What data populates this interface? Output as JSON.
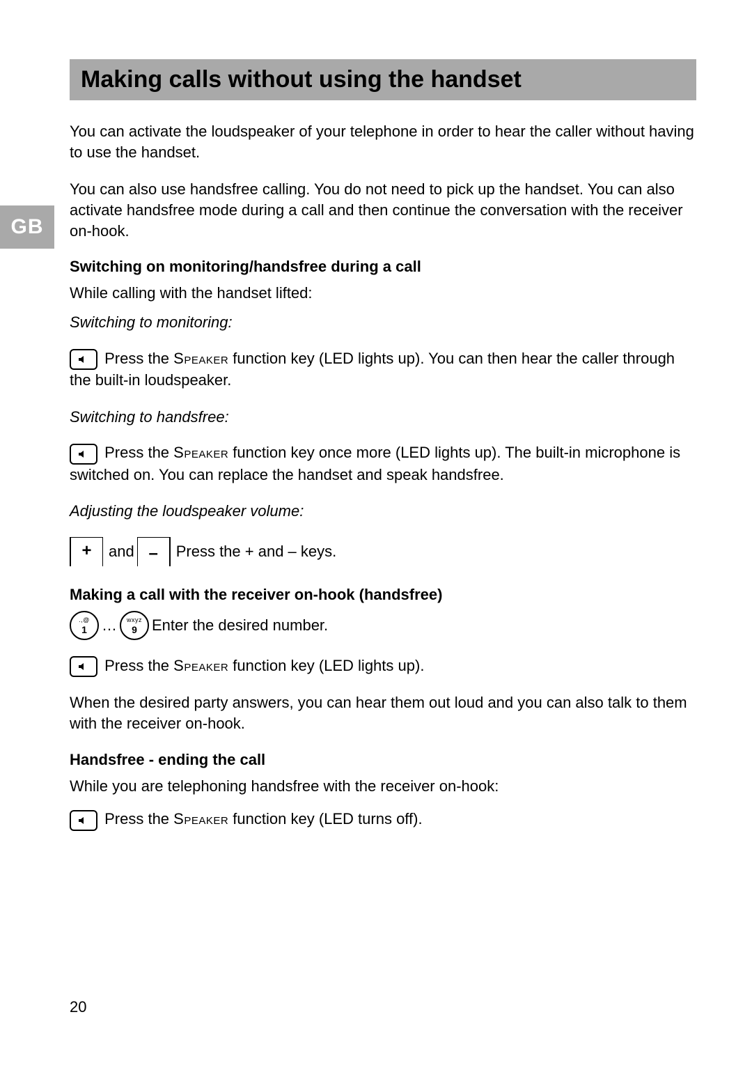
{
  "sidebar": {
    "label": "GB"
  },
  "title": "Making calls without using the handset",
  "intro1": "You can activate the loudspeaker of your telephone in order to hear the caller without having to use the handset.",
  "intro2": "You can also use handsfree calling. You do not need to pick up the handset. You can also activate handsfree mode during a call and then continue the conversation with the receiver on-hook.",
  "section1": {
    "heading": "Switching on monitoring/handsfree during a call",
    "line1": "While calling with the handset lifted:",
    "sub1": "Switching to monitoring:",
    "instr1_pre": " Press the ",
    "instr1_key": "Speaker",
    "instr1_post": " function key (LED lights up). You can then hear the caller through the built-in loudspeaker.",
    "sub2": "Switching to handsfree:",
    "instr2_pre": " Press the ",
    "instr2_key": "Speaker",
    "instr2_post": " function key once more (LED lights up). The built-in microphone is switched on. You can replace the handset and speak handsfree.",
    "sub3": "Adjusting the loudspeaker volume:",
    "volume_and": " and ",
    "volume_text": " Press the + and – keys."
  },
  "section2": {
    "heading": "Making a call with the receiver on-hook (handsfree)",
    "num_ellipsis": "…",
    "num_text": " Enter the desired number.",
    "instr_pre": " Press the ",
    "instr_key": "Speaker",
    "instr_post": " function key (LED lights up).",
    "result": "When the desired party answers, you can hear them out loud and you can also talk to them with the receiver on-hook."
  },
  "section3": {
    "heading": "Handsfree - ending the call",
    "line1": "While you are telephoning handsfree with the receiver on-hook:",
    "instr_pre": " Press the ",
    "instr_key": "Speaker",
    "instr_post": " function key (LED turns off)."
  },
  "keys": {
    "plus": "+",
    "minus": "–",
    "num1_top": ".,@",
    "num1_bot": "1",
    "num9_top": "wxyz",
    "num9_bot": "9"
  },
  "page_number": "20"
}
